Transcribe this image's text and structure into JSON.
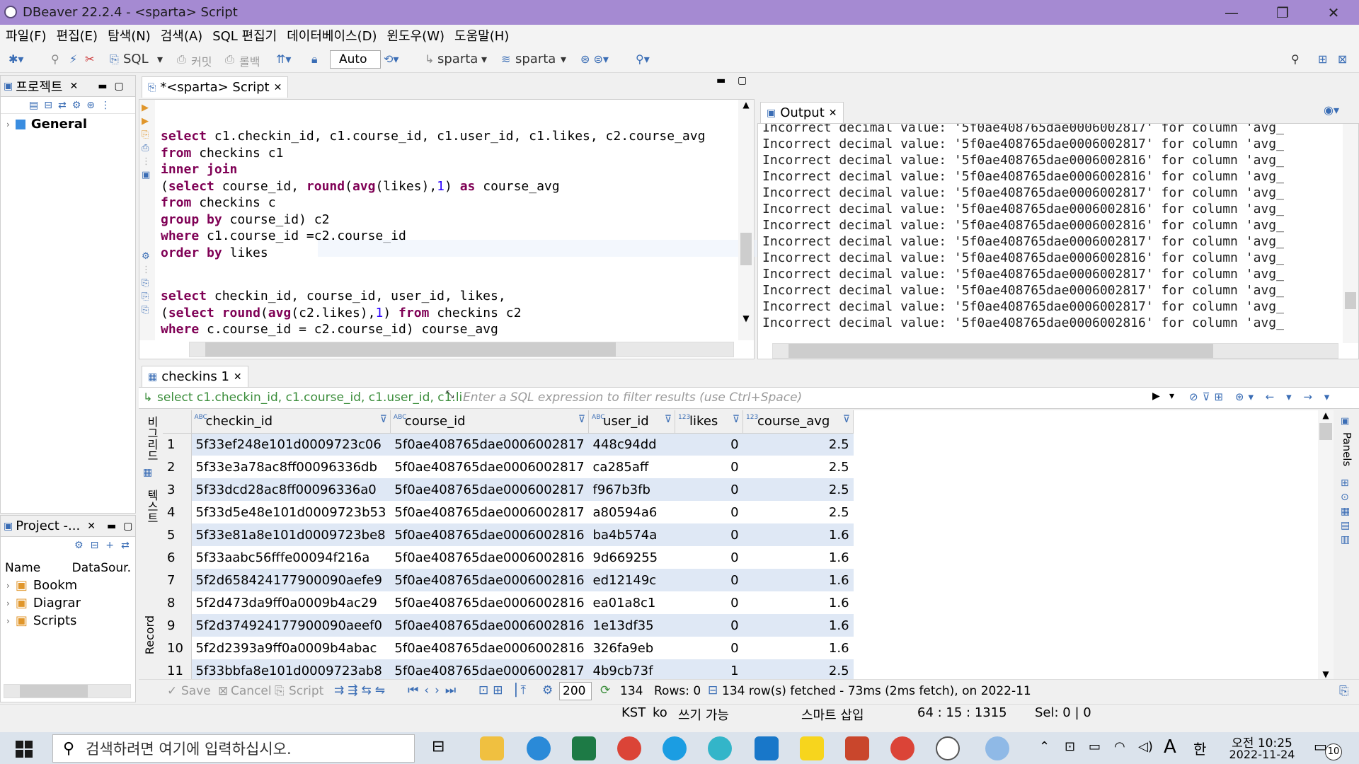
{
  "window": {
    "title": "DBeaver 22.2.4 - <sparta> Script"
  },
  "menu": [
    "파일(F)",
    "편집(E)",
    "탐색(N)",
    "검색(A)",
    "SQL 편집기",
    "데이터베이스(D)",
    "윈도우(W)",
    "도움말(H)"
  ],
  "toolbar": {
    "sql_label": "SQL",
    "commit_label": "커밋",
    "rollback_label": "롤백",
    "txn_mode": "Auto",
    "datasource": "sparta",
    "schema": "sparta"
  },
  "left_panel": {
    "project_tab": "프로젝트",
    "tree_root": "General",
    "bottom_tab": "Project -...",
    "columns": [
      "Name",
      "DataSour."
    ],
    "items": [
      "Bookm",
      "Diagrar",
      "Scripts"
    ]
  },
  "editor": {
    "tab_label": "*<sparta> Script",
    "block1": [
      [
        [
          "kw",
          "select"
        ],
        [
          "t",
          " c1.checkin_id, c1.course_id, c1.user_id, c1.likes, c2.course_avg"
        ]
      ],
      [
        [
          "kw",
          "from"
        ],
        [
          "t",
          " checkins c1"
        ]
      ],
      [
        [
          "kw",
          "inner join"
        ]
      ],
      [
        [
          "t",
          "("
        ],
        [
          "kw",
          "select"
        ],
        [
          "t",
          " course_id, "
        ],
        [
          "kw",
          "round"
        ],
        [
          "t",
          "("
        ],
        [
          "kw",
          "avg"
        ],
        [
          "t",
          "(likes),"
        ],
        [
          "num",
          "1"
        ],
        [
          "t",
          ") "
        ],
        [
          "kw",
          "as"
        ],
        [
          "t",
          " course_avg"
        ]
      ],
      [
        [
          "kw",
          "from"
        ],
        [
          "t",
          " checkins c"
        ]
      ],
      [
        [
          "kw",
          "group by"
        ],
        [
          "t",
          " course_id) c2"
        ]
      ],
      [
        [
          "kw",
          "where"
        ],
        [
          "t",
          " c1.course_id =c2.course_id"
        ]
      ],
      [
        [
          "kw",
          "order by"
        ],
        [
          "t",
          " likes"
        ]
      ]
    ],
    "block2": [
      [
        [
          "kw",
          "select"
        ],
        [
          "t",
          " checkin_id, course_id, user_id, likes,"
        ]
      ],
      [
        [
          "t",
          "("
        ],
        [
          "kw",
          "select"
        ],
        [
          "t",
          " "
        ],
        [
          "kw",
          "round"
        ],
        [
          "t",
          "("
        ],
        [
          "kw",
          "avg"
        ],
        [
          "t",
          "(c2.likes),"
        ],
        [
          "num",
          "1"
        ],
        [
          "t",
          ") "
        ],
        [
          "kw",
          "from"
        ],
        [
          "t",
          " checkins c2"
        ]
      ],
      [
        [
          "kw",
          "where"
        ],
        [
          "t",
          " c.course_id = c2.course_id) course_avg"
        ]
      ]
    ]
  },
  "output": {
    "tab_label": "Output",
    "lines": [
      "Incorrect decimal value: '5f0ae408765dae0006002817' for column 'avg_",
      "Incorrect decimal value: '5f0ae408765dae0006002817' for column 'avg_",
      "Incorrect decimal value: '5f0ae408765dae0006002816' for column 'avg_",
      "Incorrect decimal value: '5f0ae408765dae0006002816' for column 'avg_",
      "Incorrect decimal value: '5f0ae408765dae0006002817' for column 'avg_",
      "Incorrect decimal value: '5f0ae408765dae0006002816' for column 'avg_",
      "Incorrect decimal value: '5f0ae408765dae0006002816' for column 'avg_",
      "Incorrect decimal value: '5f0ae408765dae0006002817' for column 'avg_",
      "Incorrect decimal value: '5f0ae408765dae0006002816' for column 'avg_",
      "Incorrect decimal value: '5f0ae408765dae0006002817' for column 'avg_",
      "Incorrect decimal value: '5f0ae408765dae0006002817' for column 'avg_",
      "Incorrect decimal value: '5f0ae408765dae0006002817' for column 'avg_",
      "Incorrect decimal value: '5f0ae408765dae0006002816' for column 'avg_"
    ]
  },
  "results": {
    "tab_label": "checkins 1",
    "query_preview": "select c1.checkin_id, c1.course_id, c1.user_id, c1.li",
    "filter_placeholder": "Enter a SQL expression to filter results (use Ctrl+Space)",
    "side_label_grid": "비그리드",
    "side_label_text": "텍스트",
    "side_label_record": "Record",
    "right_label": "Panels",
    "columns": [
      {
        "name": "checkin_id",
        "type": "ABC"
      },
      {
        "name": "course_id",
        "type": "ABC"
      },
      {
        "name": "user_id",
        "type": "ABC"
      },
      {
        "name": "likes",
        "type": "123"
      },
      {
        "name": "course_avg",
        "type": "123"
      }
    ],
    "rows": [
      [
        "1",
        "5f33ef248e101d0009723c06",
        "5f0ae408765dae0006002817",
        "448c94dd",
        "0",
        "2.5"
      ],
      [
        "2",
        "5f33e3a78ac8ff00096336db",
        "5f0ae408765dae0006002817",
        "ca285aff",
        "0",
        "2.5"
      ],
      [
        "3",
        "5f33dcd28ac8ff00096336a0",
        "5f0ae408765dae0006002817",
        "f967b3fb",
        "0",
        "2.5"
      ],
      [
        "4",
        "5f33d5e48e101d0009723b53",
        "5f0ae408765dae0006002817",
        "a80594a6",
        "0",
        "2.5"
      ],
      [
        "5",
        "5f33e81a8e101d0009723be8",
        "5f0ae408765dae0006002816",
        "ba4b574a",
        "0",
        "1.6"
      ],
      [
        "6",
        "5f33aabc56fffe00094f216a",
        "5f0ae408765dae0006002816",
        "9d669255",
        "0",
        "1.6"
      ],
      [
        "7",
        "5f2d658424177900090aefe9",
        "5f0ae408765dae0006002816",
        "ed12149c",
        "0",
        "1.6"
      ],
      [
        "8",
        "5f2d473da9ff0a0009b4ac29",
        "5f0ae408765dae0006002816",
        "ea01a8c1",
        "0",
        "1.6"
      ],
      [
        "9",
        "5f2d374924177900090aeef0",
        "5f0ae408765dae0006002816",
        "1e13df35",
        "0",
        "1.6"
      ],
      [
        "10",
        "5f2d2393a9ff0a0009b4abac",
        "5f0ae408765dae0006002816",
        "326fa9eb",
        "0",
        "1.6"
      ],
      [
        "11",
        "5f33bbfa8e101d0009723ab8",
        "5f0ae408765dae0006002817",
        "4b9cb73f",
        "1",
        "2.5"
      ]
    ],
    "bottom": {
      "save": "Save",
      "cancel": "Cancel",
      "script": "Script",
      "fetch_size": "200",
      "count": "134",
      "rows_label": "Rows: 0",
      "fetched": "134 row(s) fetched - 73ms (2ms fetch), on 2022-11"
    }
  },
  "statusbar": {
    "tz": "KST",
    "locale": "ko",
    "mode": "쓰기 가능",
    "insert": "스마트 삽입",
    "pos": "64 : 15 : 1315",
    "sel": "Sel: 0 | 0"
  },
  "taskbar": {
    "search_placeholder": "검색하려면 여기에 입력하십시오.",
    "time": "오전 10:25",
    "date": "2022-11-24",
    "ime": "한",
    "ime2": "A",
    "notif": "10"
  }
}
